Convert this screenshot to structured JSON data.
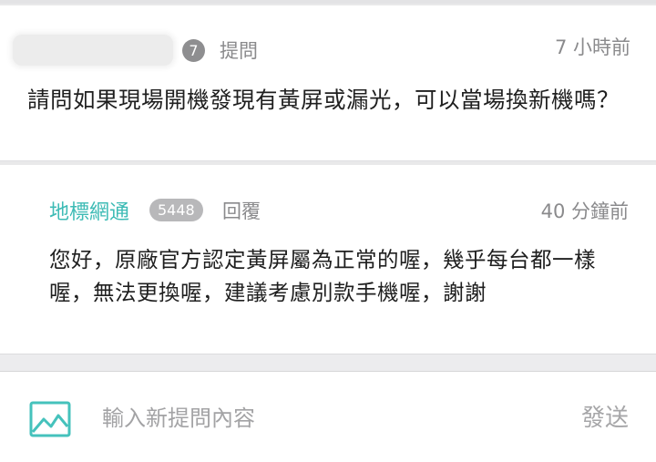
{
  "question": {
    "user_level": "7",
    "action": "提問",
    "time": "7 小時前",
    "body": "請問如果現場開機發現有黃屏或漏光，可以當場換新機嗎？"
  },
  "answer": {
    "author": "地標網通",
    "badge": "5448",
    "action": "回覆",
    "time": "40 分鐘前",
    "body": "您好，原廠官方認定黃屏屬為正常的喔，幾乎每台都一樣喔，無法更換喔，建議考慮別款手機喔，謝謝"
  },
  "composer": {
    "icon": "image-icon",
    "placeholder": "輸入新提問內容",
    "value": "",
    "send_label": "發送"
  },
  "colors": {
    "accent": "#3dbbb5",
    "muted_text": "#8a8a8c",
    "badge": "#8e8e90"
  }
}
